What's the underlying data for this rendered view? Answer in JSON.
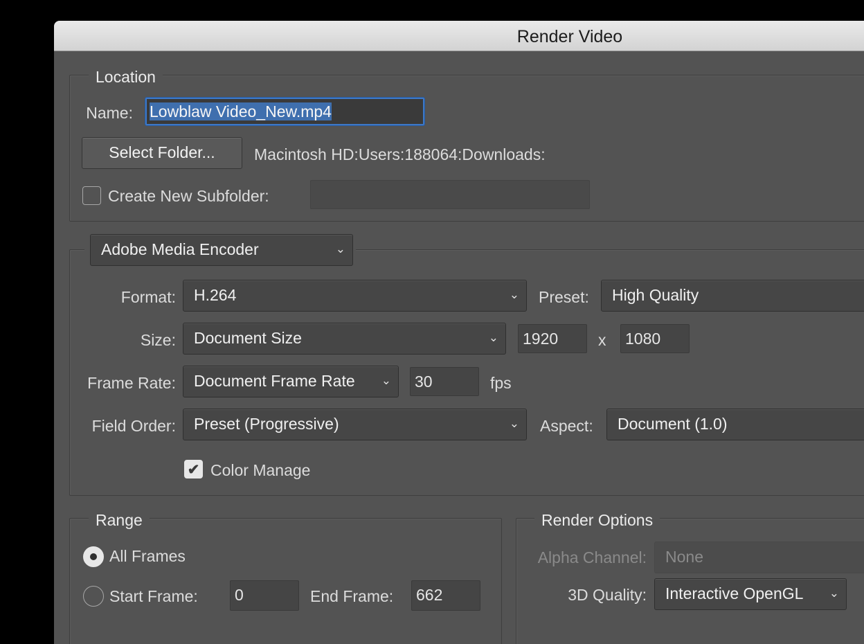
{
  "window": {
    "title": "Render Video"
  },
  "location": {
    "legend": "Location",
    "name_label": "Name:",
    "name_value": "Lowblaw Video_New.mp4",
    "select_folder_label": "Select Folder...",
    "folder_path": "Macintosh HD:Users:188064:Downloads:",
    "create_subfolder_label": "Create New Subfolder:",
    "create_subfolder_checked": false,
    "subfolder_value": ""
  },
  "encoder": {
    "selected": "Adobe Media Encoder",
    "format_label": "Format:",
    "format_value": "H.264",
    "preset_label": "Preset:",
    "preset_value": "High Quality",
    "size_label": "Size:",
    "size_value": "Document Size",
    "width": "1920",
    "size_separator": "x",
    "height": "1080",
    "frame_rate_label": "Frame Rate:",
    "frame_rate_value": "Document Frame Rate",
    "fps_value": "30",
    "fps_unit": "fps",
    "field_order_label": "Field Order:",
    "field_order_value": "Preset (Progressive)",
    "aspect_label": "Aspect:",
    "aspect_value": "Document (1.0)",
    "color_manage_label": "Color Manage",
    "color_manage_checked": true
  },
  "range": {
    "legend": "Range",
    "all_frames_label": "All Frames",
    "all_frames_selected": true,
    "start_frame_label": "Start Frame:",
    "start_frame_value": "0",
    "end_frame_label": "End Frame:",
    "end_frame_value": "662"
  },
  "render_options": {
    "legend": "Render Options",
    "alpha_label": "Alpha Channel:",
    "alpha_value": "None",
    "quality_label": "3D Quality:",
    "quality_value": "Interactive OpenGL"
  },
  "icons": {
    "chevron": "chevron-down-icon",
    "check": "checkmark-icon",
    "check_glyph": "✔",
    "chevron_glyph": "⌄"
  },
  "colors": {
    "dialog_bg": "#535353",
    "titlebar_bg": "#d8d8d8",
    "focus_ring": "#3d78c7",
    "selection": "#3f6fae"
  }
}
